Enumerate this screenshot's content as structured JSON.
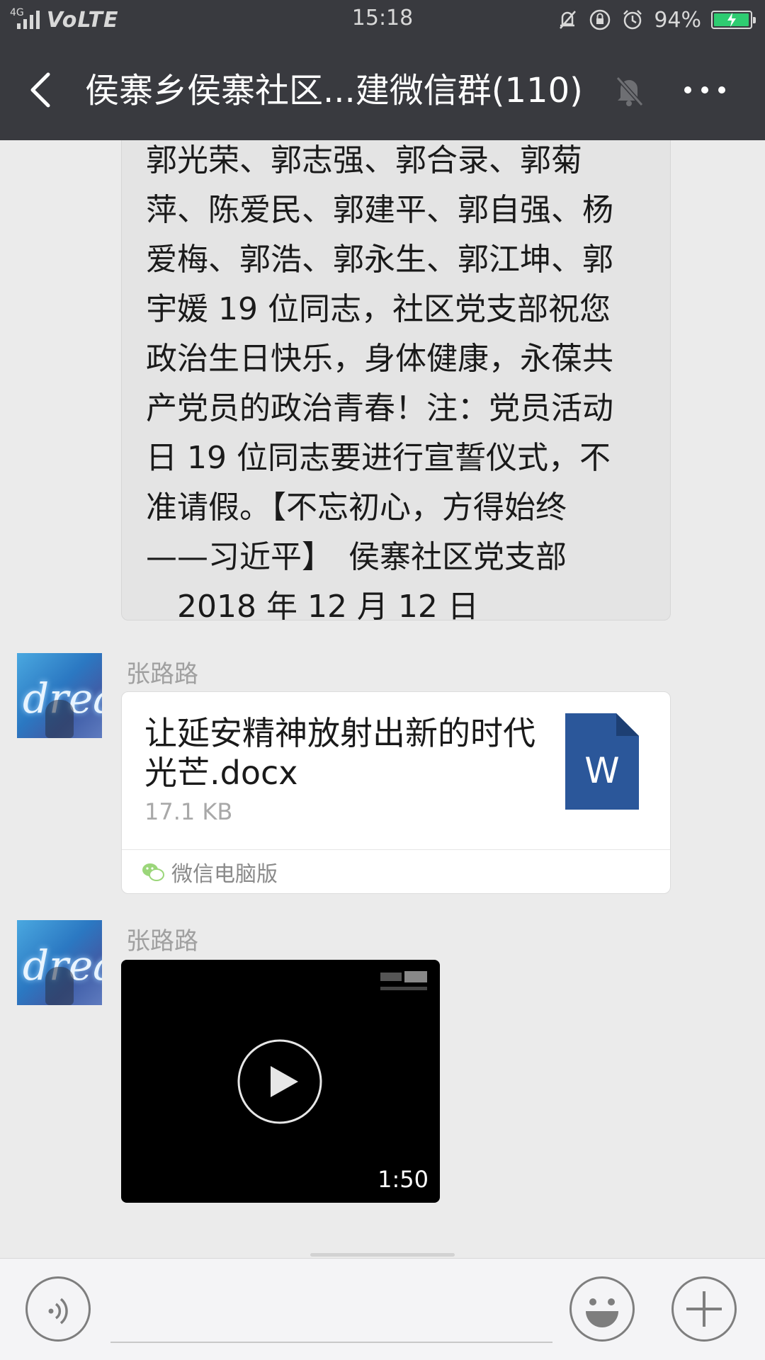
{
  "status_bar": {
    "network": "4G",
    "carrier_tag": "VoLTE",
    "time": "15:18",
    "battery_percent": "94%"
  },
  "title_bar": {
    "title": "侯寨乡侯寨社区...建微信群(110)"
  },
  "messages": {
    "text_message": {
      "lines": [
        "郭光荣、郭志强、郭合录、郭菊",
        "萍、陈爱民、郭建平、郭自强、杨",
        "爱梅、郭浩、郭永生、郭江坤、郭",
        "宇媛 19 位同志，社区党支部祝您",
        "政治生日快乐，身体健康，永葆共",
        "产党员的政治青春！注：党员活动",
        "日 19 位同志要进行宣誓仪式，不",
        "准请假。【不忘初心，方得始终",
        "——习近平】　侯寨社区党支部",
        "　2018 年 12 月 12 日"
      ]
    },
    "file_message": {
      "sender": "张路路",
      "avatar_text": "drea",
      "file_name": "让延安精神放射出新的时代光芒.docx",
      "file_size": "17.1 KB",
      "file_icon_letter": "W",
      "source": "微信电脑版"
    },
    "video_message": {
      "sender": "张路路",
      "avatar_text": "drea",
      "duration": "1:50"
    }
  },
  "colors": {
    "header_bg": "#393a3f",
    "chat_bg": "#ebebeb",
    "word_blue": "#2b579a",
    "battery_green": "#2ecc71"
  },
  "icons": {
    "back": "back-arrow-icon",
    "mute": "muted-bell-icon",
    "more": "more-dots-icon",
    "voice": "voice-icon",
    "emoji": "emoji-icon",
    "plus": "plus-icon",
    "play": "play-icon"
  }
}
